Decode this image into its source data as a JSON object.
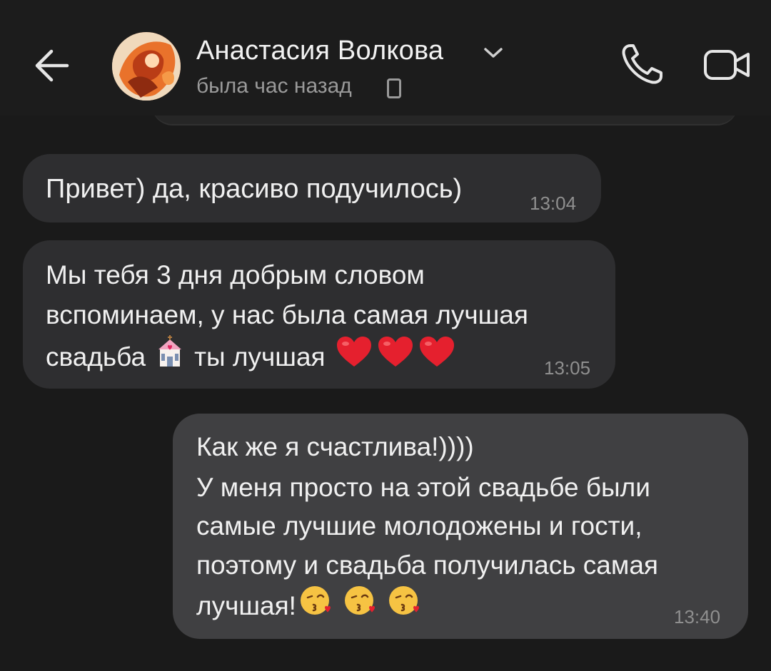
{
  "contact": {
    "name": "Анастасия Волкова",
    "status": "была час назад"
  },
  "icons": {
    "back": "arrow-left-icon",
    "chevron": "chevron-down-icon",
    "device": "phone-device-icon",
    "call": "phone-call-icon",
    "video": "video-camera-icon",
    "wedding": "wedding-chapel-emoji",
    "heart": "red-heart-emoji",
    "kiss": "face-blowing-kiss-emoji"
  },
  "colors": {
    "background": "#1a1a1a",
    "incoming_bubble": "#2e2e30",
    "outgoing_bubble": "#404042",
    "text": "#f0f0f0",
    "meta": "#8f8f8f"
  },
  "messages": [
    {
      "direction": "incoming",
      "lines": [
        "Привет) да, красиво подучилось)"
      ],
      "time": "13:04"
    },
    {
      "direction": "incoming",
      "lines": [
        "Мы тебя 3 дня добрым словом",
        "вспоминаем, у нас была самая лучшая",
        "свадьба",
        "ты лучшая"
      ],
      "time": "13:05"
    },
    {
      "direction": "outgoing",
      "lines": [
        "Как же я счастлива!))))",
        "У меня просто на этой свадьбе были",
        "самые лучшие молодожены и гости,",
        "поэтому и свадьба получилась самая",
        "лучшая!"
      ],
      "time": "13:40"
    }
  ]
}
